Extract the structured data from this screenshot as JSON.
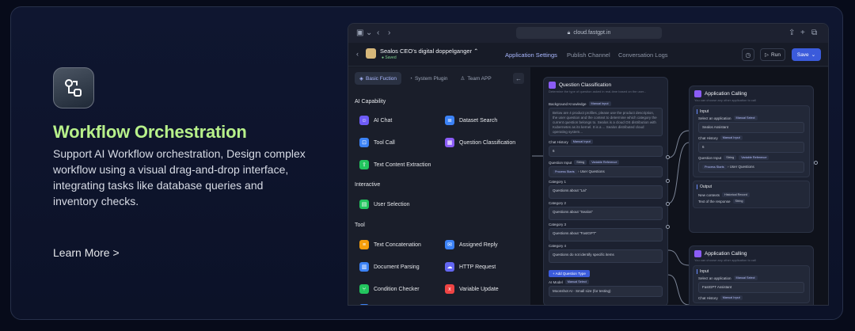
{
  "feature": {
    "icon": "workflow-icon",
    "title": "Workflow Orchestration",
    "description": "Support AI Workflow orchestration, Design complex workflow using a visual drag-and-drop interface, integrating tasks like database queries and inventory checks.",
    "learn_more": "Learn More >"
  },
  "browser": {
    "url": "cloud.fastgpt.in"
  },
  "app": {
    "name": "Sealos CEO's digital doppelganger",
    "saved": "Saved",
    "tabs": [
      "Application Settings",
      "Publish Channel",
      "Conversation Logs"
    ],
    "run": "Run",
    "save": "Save"
  },
  "panel": {
    "tabs": [
      "Basic Fuction",
      "System Plugin",
      "Team APP"
    ],
    "sections": {
      "ai": "AI Capability",
      "interactive": "Interactive",
      "tool": "Tool"
    },
    "ai_tools": [
      {
        "label": "AI Chat",
        "color": "#6d5bf6"
      },
      {
        "label": "Dataset Search",
        "color": "#3b82f6"
      },
      {
        "label": "Tool Call",
        "color": "#3b82f6"
      },
      {
        "label": "Question Classification",
        "color": "#8b5cf6"
      },
      {
        "label": "Text Content Extraction",
        "color": "#22c55e"
      }
    ],
    "interactive_tools": [
      {
        "label": "User Selection",
        "color": "#22c55e"
      }
    ],
    "tool_tools": [
      {
        "label": "Text Concatenation",
        "color": "#f59e0b"
      },
      {
        "label": "Assigned Reply",
        "color": "#3b82f6"
      },
      {
        "label": "Document Parsing",
        "color": "#3b82f6"
      },
      {
        "label": "HTTP Request",
        "color": "#6366f1"
      },
      {
        "label": "Condition Checker",
        "color": "#22c55e"
      },
      {
        "label": "Variable Update",
        "color": "#ef4444"
      }
    ]
  },
  "question_node": {
    "title": "Question Classification",
    "subtitle": "Determine the type of question asked in real-time based on the user...",
    "background_label": "Background Knowledge",
    "manual_input": "Manual Input",
    "background_text": "Below are 4 product profiles, please use the product description, the user question and the context to determine which category the current question belongs to. Sealos is a cloud OS distribution with Kubernetes as its kernel. It is a ... Sealos distributed cloud operating system...",
    "chat_history_label": "Chat History",
    "chat_history_value": "6",
    "question_input_label": "Question Input",
    "string": "String",
    "variable_reference": "Variable Reference",
    "process_starts": "Process Starts",
    "user_questions": "User Questions",
    "categories": [
      {
        "label": "Category 1",
        "value": "Questions about \"Lai\""
      },
      {
        "label": "Category 2",
        "value": "Questions about \"Sealos\""
      },
      {
        "label": "Category 3",
        "value": "Questions about \"FastGPT\""
      },
      {
        "label": "Category 4",
        "value": "Questions do not identify specific items"
      }
    ],
    "add_question_type": "+ Add Question Type",
    "ai_model_label": "AI Model",
    "manual_select": "Manual Select",
    "ai_model_value": "Moonshot AI - Small size (for testing)"
  },
  "app_node_1": {
    "title": "Application Calling",
    "subtitle": "You can choose any other application to call",
    "input": "Input",
    "select_app_label": "Select an application",
    "manual_select": "Manual Select",
    "select_app_value": "Sealos Assistant",
    "chat_history_label": "Chat History",
    "manual_input": "Manual Input",
    "chat_history_value": "6",
    "question_input_label": "Question Input",
    "string": "String",
    "variable_reference": "Variable Reference",
    "process_starts": "Process Starts",
    "user_questions": "User Questions",
    "output": "Output",
    "new_contexts": "New contexts",
    "historical_record": "Historical Record",
    "text_response": "Text of the response",
    "string2": "String"
  },
  "app_node_2": {
    "title": "Application Calling",
    "subtitle": "You can choose any other application to call",
    "input": "Input",
    "select_app_label": "Select an application",
    "manual_select": "Manual Select",
    "select_app_value": "FastGPT Assistant",
    "chat_history_label": "Chat History",
    "manual_input": "Manual Input"
  }
}
